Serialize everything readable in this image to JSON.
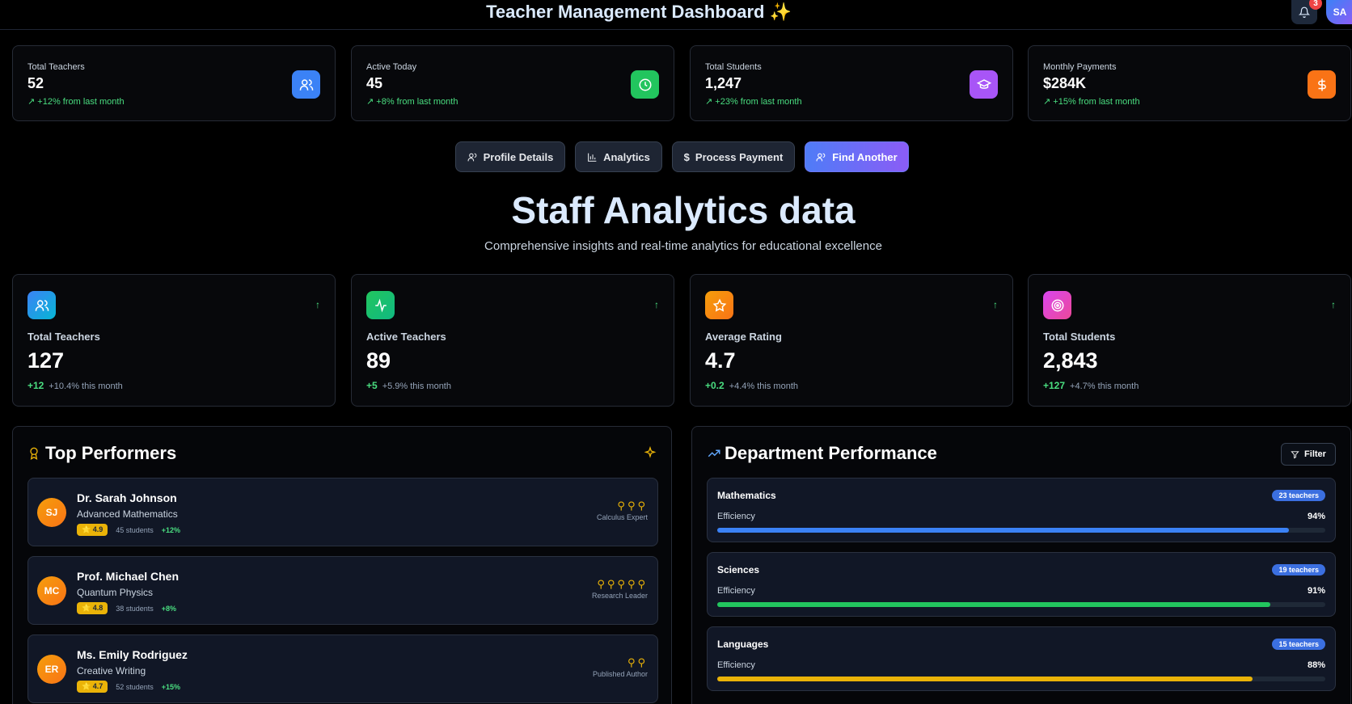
{
  "header": {
    "title": "Teacher Management Dashboard",
    "title_icon": "sparkles-icon",
    "notification_count": "3",
    "user_initials": "SA"
  },
  "stats": [
    {
      "label": "Total Teachers",
      "value": "52",
      "change": "+12% from last month",
      "icon": "users-icon",
      "color": "#3b82f6"
    },
    {
      "label": "Active Today",
      "value": "45",
      "change": "+8% from last month",
      "icon": "clock-icon",
      "color": "#22c55e"
    },
    {
      "label": "Total Students",
      "value": "1,247",
      "change": "+23% from last month",
      "icon": "graduation-cap-icon",
      "color": "#a855f7"
    },
    {
      "label": "Monthly Payments",
      "value": "$284K",
      "change": "+15% from last month",
      "icon": "dollar-icon",
      "color": "#f97316"
    }
  ],
  "actions": {
    "profile": "Profile Details",
    "analytics": "Analytics",
    "payment": "Process Payment",
    "find": "Find Another"
  },
  "hero": {
    "title": "Staff Analytics data",
    "subtitle": "Comprehensive insights and real-time analytics for educational excellence"
  },
  "analytics": [
    {
      "label": "Total Teachers",
      "value": "127",
      "delta": "+12",
      "note": "+10.4% this month",
      "icon": "users-icon",
      "color": "#3b82f6"
    },
    {
      "label": "Active Teachers",
      "value": "89",
      "delta": "+5",
      "note": "+5.9% this month",
      "icon": "activity-icon",
      "color": "#22c55e"
    },
    {
      "label": "Average Rating",
      "value": "4.7",
      "delta": "+0.2",
      "note": "+4.4% this month",
      "icon": "star-icon",
      "color": "#f59e0b"
    },
    {
      "label": "Total Students",
      "value": "2,843",
      "delta": "+127",
      "note": "+4.7% this month",
      "icon": "target-icon",
      "color": "#d946ef"
    }
  ],
  "top_performers": {
    "title": "Top Performers",
    "items": [
      {
        "initials": "SJ",
        "name": "Dr. Sarah Johnson",
        "subject": "Advanced Mathematics",
        "rating": "4.9",
        "students": "45 students",
        "growth": "+12%",
        "badge_count": 3,
        "badge_title": "Calculus Expert"
      },
      {
        "initials": "MC",
        "name": "Prof. Michael Chen",
        "subject": "Quantum Physics",
        "rating": "4.8",
        "students": "38 students",
        "growth": "+8%",
        "badge_count": 5,
        "badge_title": "Research Leader"
      },
      {
        "initials": "ER",
        "name": "Ms. Emily Rodriguez",
        "subject": "Creative Writing",
        "rating": "4.7",
        "students": "52 students",
        "growth": "+15%",
        "badge_count": 2,
        "badge_title": "Published Author"
      }
    ]
  },
  "departments": {
    "title": "Department Performance",
    "filter_label": "Filter",
    "items": [
      {
        "name": "Mathematics",
        "teachers": "23 teachers",
        "metric": "Efficiency",
        "percent": "94%",
        "value": 94,
        "color": "#3b82f6"
      },
      {
        "name": "Sciences",
        "teachers": "19 teachers",
        "metric": "Efficiency",
        "percent": "91%",
        "value": 91,
        "color": "#22c55e"
      },
      {
        "name": "Languages",
        "teachers": "15 teachers",
        "metric": "Efficiency",
        "percent": "88%",
        "value": 88,
        "color": "#eab308"
      }
    ]
  }
}
